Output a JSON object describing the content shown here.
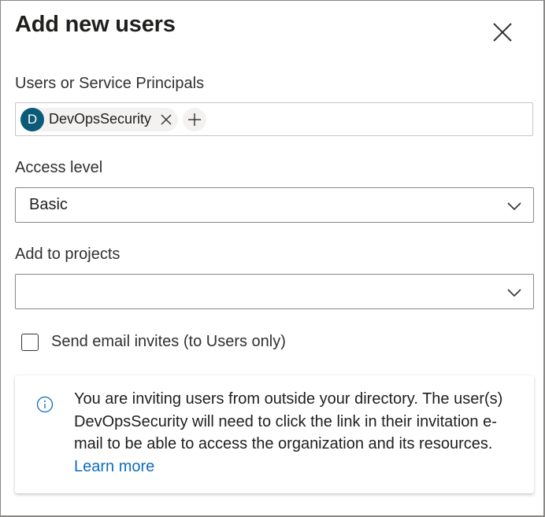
{
  "dialog": {
    "title": "Add new users",
    "close_label": "Close"
  },
  "users_field": {
    "label": "Users or Service Principals",
    "chips": [
      {
        "initial": "D",
        "name": "DevOpsSecurity",
        "avatar_color": "#0b5a78"
      }
    ],
    "remove_icon": "close-icon",
    "add_icon": "plus-icon"
  },
  "access_level": {
    "label": "Access level",
    "selected": "Basic",
    "icon": "chevron-down-icon"
  },
  "projects": {
    "label": "Add to projects",
    "selected": "",
    "icon": "chevron-down-icon"
  },
  "email_invites": {
    "label": "Send email invites (to Users only)",
    "checked": false
  },
  "info_message": {
    "icon": "info-icon",
    "text": "You are inviting users from outside your directory. The user(s) DevOpsSecurity will need to click the link in their invitation e-mail to be able to access the organization and its resources.",
    "link_text": "Learn more"
  },
  "colors": {
    "link": "#0f6cbd",
    "avatar": "#0b5a78",
    "border": "#8a8886"
  }
}
